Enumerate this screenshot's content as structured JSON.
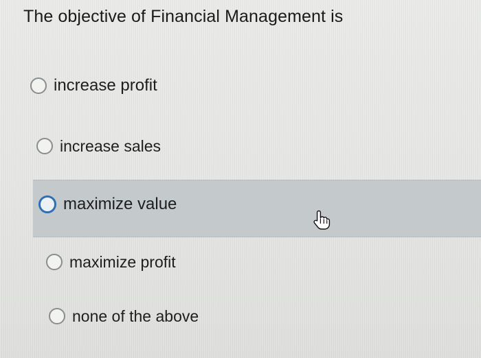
{
  "question": {
    "text": "The objective of Financial Management is"
  },
  "options": [
    {
      "label": "increase profit",
      "state": "default"
    },
    {
      "label": "increase sales",
      "state": "default"
    },
    {
      "label": "maximize value",
      "state": "hover"
    },
    {
      "label": "maximize profit",
      "state": "default"
    },
    {
      "label": "none of the above",
      "state": "default"
    }
  ],
  "colors": {
    "hover_band": "#c4c9cc",
    "radio_border": "#8a8d8e",
    "radio_hover_border": "#2e6fb5"
  },
  "icons": {
    "cursor": "hand-pointer-icon"
  }
}
